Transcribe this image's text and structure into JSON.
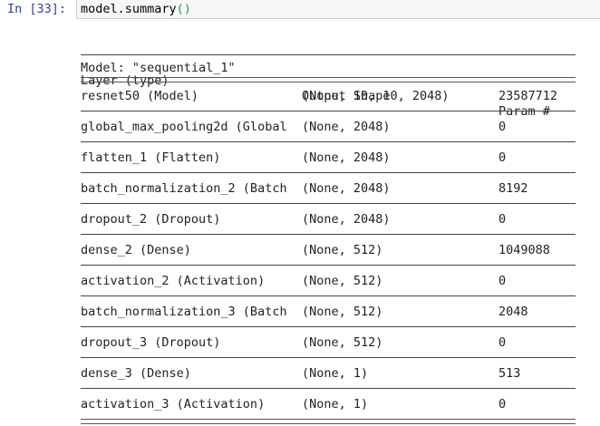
{
  "cell": {
    "prompt": "In [33]:",
    "code_object": "model.summary",
    "code_parens": "()"
  },
  "summary": {
    "model_line": "Model: \"sequential_1\"",
    "headers": [
      "Layer (type)",
      "Output Shape",
      "Param #"
    ],
    "rows": [
      [
        "resnet50 (Model)",
        "(None, 10, 10, 2048)",
        "23587712"
      ],
      [
        "global_max_pooling2d (Global",
        "(None, 2048)",
        "0"
      ],
      [
        "flatten_1 (Flatten)",
        "(None, 2048)",
        "0"
      ],
      [
        "batch_normalization_2 (Batch",
        "(None, 2048)",
        "8192"
      ],
      [
        "dropout_2 (Dropout)",
        "(None, 2048)",
        "0"
      ],
      [
        "dense_2 (Dense)",
        "(None, 512)",
        "1049088"
      ],
      [
        "activation_2 (Activation)",
        "(None, 512)",
        "0"
      ],
      [
        "batch_normalization_3 (Batch",
        "(None, 512)",
        "2048"
      ],
      [
        "dropout_3 (Dropout)",
        "(None, 512)",
        "0"
      ],
      [
        "dense_3 (Dense)",
        "(None, 1)",
        "513"
      ],
      [
        "activation_3 (Activation)",
        "(None, 1)",
        "0"
      ]
    ]
  },
  "colors": {
    "prompt": "#303f9f",
    "paren": "#2e9c3a",
    "cell_bg": "#f7f7f7"
  }
}
